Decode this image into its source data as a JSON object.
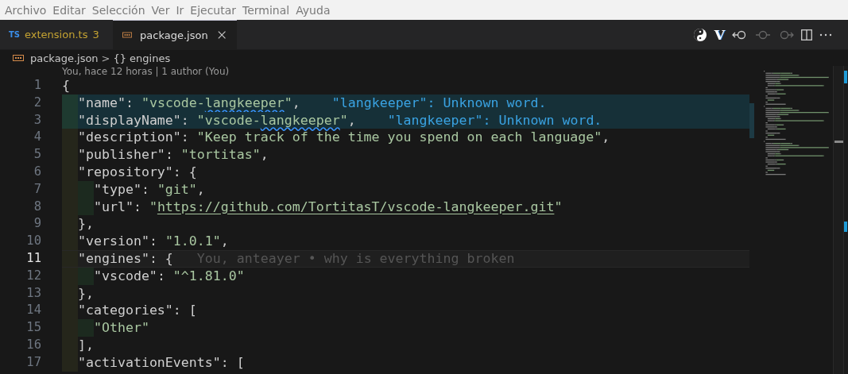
{
  "menu_bar": {
    "items": [
      "Archivo",
      "Editar",
      "Selección",
      "Ver",
      "Ir",
      "Ejecutar",
      "Terminal",
      "Ayuda"
    ]
  },
  "tabs": [
    {
      "icon_text": "TS",
      "label": "extension.ts",
      "badge": "3",
      "selected": false,
      "warning": true
    },
    {
      "label": "package.json",
      "selected": true,
      "warning": false
    }
  ],
  "toolbar": {
    "letter_action": "V"
  },
  "breadcrumb": {
    "file": "package.json",
    "separator": ">",
    "symbol_icon": "{}",
    "symbol": "engines"
  },
  "codelens": "You, hace 12 horas | 1 author (You)",
  "lines": [
    {
      "number": "1",
      "current": false,
      "highlighted": false,
      "tokens": [
        {
          "kind": "punct",
          "text": "{"
        }
      ]
    },
    {
      "number": "2",
      "current": false,
      "highlighted": true,
      "tokens": [
        {
          "kind": "key",
          "text": "  \"name\""
        },
        {
          "kind": "punct",
          "text": ": "
        },
        {
          "kind": "string",
          "text": "\"vscode-"
        },
        {
          "kind": "misspelled",
          "text": "langkeeper"
        },
        {
          "kind": "string",
          "text": "\""
        },
        {
          "kind": "punct",
          "text": ","
        },
        {
          "kind": "hint",
          "text": "\"langkeeper\": Unknown word."
        }
      ]
    },
    {
      "number": "3",
      "current": false,
      "highlighted": true,
      "tokens": [
        {
          "kind": "key",
          "text": "  \"displayName\""
        },
        {
          "kind": "punct",
          "text": ": "
        },
        {
          "kind": "string",
          "text": "\"vscode-"
        },
        {
          "kind": "misspelled",
          "text": "langkeeper"
        },
        {
          "kind": "string",
          "text": "\""
        },
        {
          "kind": "punct",
          "text": ","
        },
        {
          "kind": "hint",
          "text": "\"langkeeper\": Unknown word."
        }
      ]
    },
    {
      "number": "4",
      "current": false,
      "highlighted": false,
      "tokens": [
        {
          "kind": "key",
          "text": "  \"description\""
        },
        {
          "kind": "punct",
          "text": ": "
        },
        {
          "kind": "string",
          "text": "\"Keep track of the time you spend on each language\""
        },
        {
          "kind": "punct",
          "text": ","
        }
      ]
    },
    {
      "number": "5",
      "current": false,
      "highlighted": false,
      "tokens": [
        {
          "kind": "key",
          "text": "  \"publisher\""
        },
        {
          "kind": "punct",
          "text": ": "
        },
        {
          "kind": "string",
          "text": "\"tortitas\""
        },
        {
          "kind": "punct",
          "text": ","
        }
      ]
    },
    {
      "number": "6",
      "current": false,
      "highlighted": false,
      "tokens": [
        {
          "kind": "key",
          "text": "  \"repository\""
        },
        {
          "kind": "punct",
          "text": ": {"
        }
      ]
    },
    {
      "number": "7",
      "current": false,
      "highlighted": false,
      "tokens": [
        {
          "kind": "key",
          "text": "    \"type\""
        },
        {
          "kind": "punct",
          "text": ": "
        },
        {
          "kind": "string",
          "text": "\"git\""
        },
        {
          "kind": "punct",
          "text": ","
        }
      ]
    },
    {
      "number": "8",
      "current": false,
      "highlighted": false,
      "tokens": [
        {
          "kind": "key",
          "text": "    \"url\""
        },
        {
          "kind": "punct",
          "text": ": "
        },
        {
          "kind": "string",
          "text": "\""
        },
        {
          "kind": "link",
          "text": "https://github.com/TortitasT/vscode-langkeeper.git"
        },
        {
          "kind": "string",
          "text": "\""
        }
      ]
    },
    {
      "number": "9",
      "current": false,
      "highlighted": false,
      "tokens": [
        {
          "kind": "punct",
          "text": "  },"
        }
      ]
    },
    {
      "number": "10",
      "current": false,
      "highlighted": false,
      "tokens": [
        {
          "kind": "key",
          "text": "  \"version\""
        },
        {
          "kind": "punct",
          "text": ": "
        },
        {
          "kind": "string",
          "text": "\"1.0.1\""
        },
        {
          "kind": "punct",
          "text": ","
        }
      ]
    },
    {
      "number": "11",
      "current": true,
      "highlighted": false,
      "tokens": [
        {
          "kind": "key",
          "text": "  \"engines\""
        },
        {
          "kind": "punct",
          "text": ": {"
        },
        {
          "kind": "blame",
          "text": "You, anteayer • why is everything broken"
        }
      ]
    },
    {
      "number": "12",
      "current": false,
      "highlighted": false,
      "tokens": [
        {
          "kind": "key",
          "text": "    \"vscode\""
        },
        {
          "kind": "punct",
          "text": ": "
        },
        {
          "kind": "string",
          "text": "\"^1.81.0\""
        }
      ]
    },
    {
      "number": "13",
      "current": false,
      "highlighted": false,
      "tokens": [
        {
          "kind": "punct",
          "text": "  },"
        }
      ]
    },
    {
      "number": "14",
      "current": false,
      "highlighted": false,
      "tokens": [
        {
          "kind": "key",
          "text": "  \"categories\""
        },
        {
          "kind": "punct",
          "text": ": ["
        }
      ]
    },
    {
      "number": "15",
      "current": false,
      "highlighted": false,
      "tokens": [
        {
          "kind": "string",
          "text": "    \"Other\""
        }
      ]
    },
    {
      "number": "16",
      "current": false,
      "highlighted": false,
      "tokens": [
        {
          "kind": "punct",
          "text": "  ],"
        }
      ]
    },
    {
      "number": "17",
      "current": false,
      "highlighted": false,
      "tokens": [
        {
          "kind": "key",
          "text": "  \"activationEvents\""
        },
        {
          "kind": "punct",
          "text": ": ["
        }
      ]
    }
  ]
}
